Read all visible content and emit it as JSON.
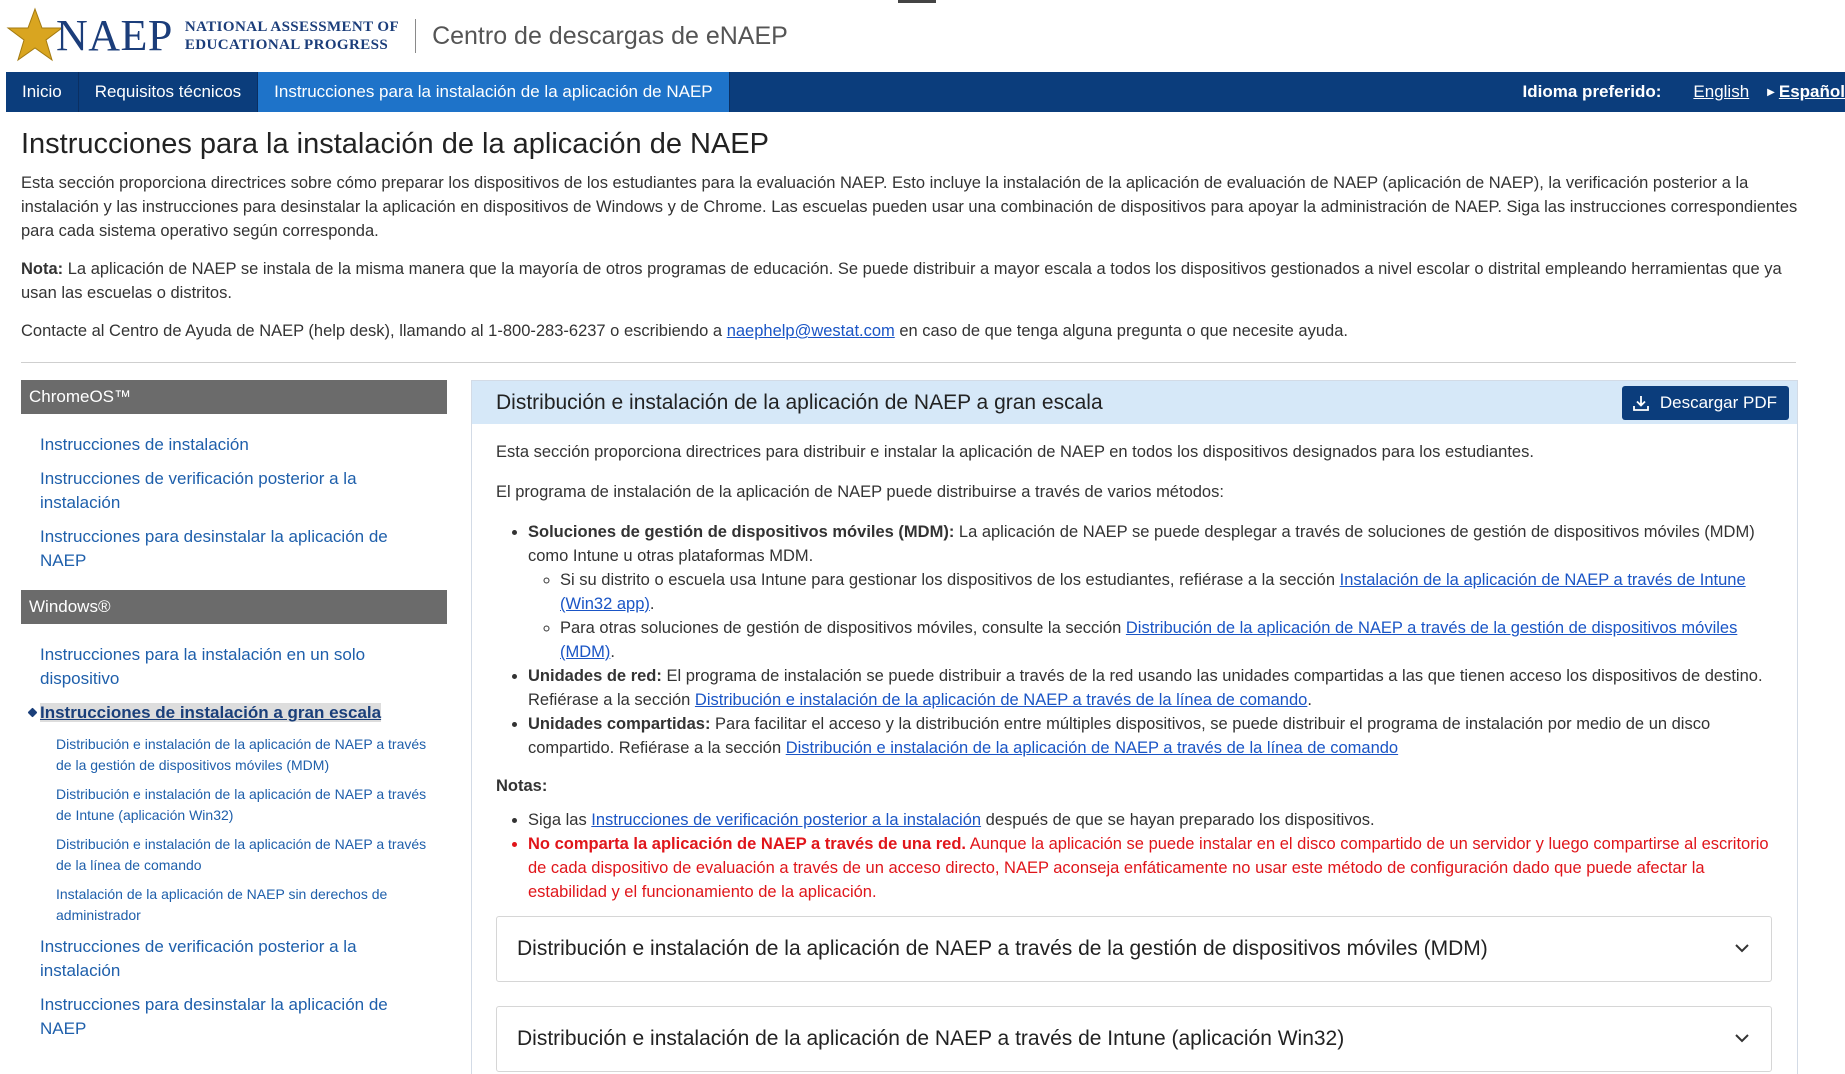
{
  "header": {
    "logo_word": "NAEP",
    "logo_sub1": "NATIONAL ASSESSMENT OF",
    "logo_sub2": "EDUCATIONAL PROGRESS",
    "title": "Centro de descargas de eNAEP"
  },
  "nav": {
    "items": [
      {
        "label": "Inicio"
      },
      {
        "label": "Requisitos técnicos"
      },
      {
        "label": "Instrucciones para la instalación de la aplicación de NAEP"
      }
    ],
    "lang_label": "Idioma preferido:",
    "lang_en": "English",
    "lang_es": "Español"
  },
  "intro": {
    "title": "Instrucciones para la instalación de la aplicación de NAEP",
    "p1": "Esta sección proporciona directrices sobre cómo preparar los dispositivos de los estudiantes para la evaluación NAEP. Esto incluye la instalación de la aplicación de evaluación de NAEP (aplicación de NAEP), la verificación posterior a la instalación y las instrucciones para desinstalar la aplicación en dispositivos de Windows y de Chrome. Las escuelas pueden usar una combinación de dispositivos para apoyar la administración de NAEP. Siga las instrucciones correspondientes para cada sistema operativo según corresponda.",
    "note_label": "Nota:",
    "note_text": " La aplicación de NAEP se instala de la misma manera que la mayoría de otros programas de educación. Se puede distribuir a mayor escala a todos los dispositivos gestionados a nivel escolar o distrital empleando herramientas que ya usan las escuelas o distritos.",
    "contact_pre": "Contacte al Centro de Ayuda de NAEP (help desk), llamando al 1-800-283-6237 o escribiendo a ",
    "contact_email": "naephelp@westat.com",
    "contact_post": " en caso de que tenga alguna pregunta o que necesite ayuda."
  },
  "sidebar": {
    "chrome_head": "ChromeOS™",
    "chrome_items": [
      "Instrucciones de instalación",
      "Instrucciones de verificación posterior a la instalación",
      "Instrucciones para desinstalar la aplicación de NAEP"
    ],
    "windows_head": "Windows®",
    "win_item1": "Instrucciones para la instalación en un solo dispositivo",
    "win_current": "Instrucciones de instalación a gran escala",
    "win_subs": [
      "Distribución e instalación de la aplicación de NAEP a través de la gestión de dispositivos móviles (MDM)",
      "Distribución e instalación de la aplicación de NAEP a través de Intune (aplicación Win32)",
      "Distribución e instalación de la aplicación de NAEP a través de la línea de comando",
      "Instalación de la aplicación de NAEP sin derechos de administrador"
    ],
    "win_item3": "Instrucciones de verificación posterior a la instalación",
    "win_item4": "Instrucciones para desinstalar la aplicación de NAEP"
  },
  "panel": {
    "title": "Distribución e instalación de la aplicación de NAEP a gran escala",
    "pdf_label": "Descargar PDF",
    "p1": "Esta sección proporciona directrices para distribuir e instalar la aplicación de NAEP en todos los dispositivos designados para los estudiantes.",
    "p2": "El programa de instalación de la aplicación de NAEP puede distribuirse a través de varios métodos:",
    "b1_label": "Soluciones de gestión de dispositivos móviles (MDM):",
    "b1_text": " La aplicación de NAEP se puede desplegar a través de soluciones de gestión de dispositivos móviles (MDM) como Intune u otras plataformas MDM.",
    "b1a_pre": "Si su distrito o escuela usa Intune para gestionar los dispositivos de los estudiantes, refiérase a la sección ",
    "b1a_link": "Instalación de la aplicación de NAEP a través de Intune (Win32 app)",
    "b1a_post": ".",
    "b1b_pre": "Para otras soluciones de gestión de dispositivos móviles, consulte la sección ",
    "b1b_link": "Distribución de la aplicación de NAEP a través de la gestión de dispositivos móviles (MDM)",
    "b1b_post": ".",
    "b2_label": "Unidades de red:",
    "b2_text": " El programa de instalación se puede distribuir a través de la red usando las unidades compartidas a las que tienen acceso los dispositivos de destino. Refiérase a la sección ",
    "b2_link": "Distribución e instalación de la aplicación de NAEP a través de la línea de comando",
    "b2_post": ".",
    "b3_label": "Unidades compartidas:",
    "b3_text": " Para facilitar el acceso y la distribución entre múltiples dispositivos, se puede distribuir el programa de instalación por medio de un disco compartido. Refiérase a la sección ",
    "b3_link": "Distribución e instalación de la aplicación de NAEP a través de la línea de comando",
    "notes_label": "Notas:",
    "n1_pre": "Siga las ",
    "n1_link": "Instrucciones de verificación posterior a la instalación",
    "n1_post": " después de que se hayan preparado los dispositivos.",
    "n2_bold": "No comparta la aplicación de NAEP a través de una red.",
    "n2_text": " Aunque la aplicación se puede instalar en el disco compartido de un servidor y luego compartirse al escritorio de cada dispositivo de evaluación a través de un acceso directo, NAEP aconseja enfáticamente no usar este método de configuración dado que puede afectar la estabilidad y el funcionamiento de la aplicación.",
    "acc1": "Distribución e instalación de la aplicación de NAEP a través de la gestión de dispositivos móviles (MDM)",
    "acc2": "Distribución e instalación de la aplicación de NAEP a través de Intune (aplicación Win32)"
  },
  "colors": {
    "nav_bg": "#0b3d7c",
    "nav_active": "#1e73c9",
    "link": "#1a55c6",
    "warning": "#e0151a",
    "sidebar_head": "#6b6b6b",
    "panel_head": "#d6e8f8"
  }
}
